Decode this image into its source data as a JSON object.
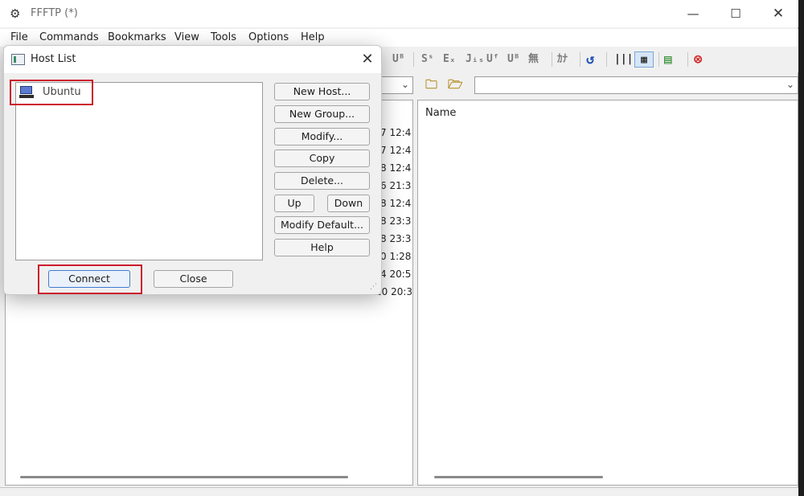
{
  "app": {
    "title": "FFFTP (*)",
    "icon": "ffftp-app-icon",
    "window_controls": {
      "minimize": "—",
      "maximize": "☐",
      "close": "✕"
    }
  },
  "menu": [
    "File",
    "Commands",
    "Bookmarks",
    "View",
    "Tools",
    "Options",
    "Help"
  ],
  "toolbar": {
    "kanji_icons": [
      "Uᴮ",
      "Sˢ",
      "Eₓ",
      "Jᵢₛ",
      "Uᶠ",
      "Uᴮ",
      "無",
      "ｶﾅ"
    ],
    "icons": [
      "refresh-icon",
      "list-view-icon",
      "detail-view-icon",
      "sync-icon",
      "stop-icon"
    ]
  },
  "right_pane": {
    "column_name": "Name"
  },
  "left_pane": {
    "times": [
      "7 12:4",
      "7 12:4",
      "8 12:4",
      "6 21:3",
      "8 12:4",
      "8 23:3",
      "8 23:3",
      "0 1:28",
      "4 20:5",
      "10 20:3"
    ]
  },
  "dialog": {
    "title": "Host List",
    "hosts": [
      {
        "label": "Ubuntu",
        "icon": "computer-icon"
      }
    ],
    "buttons": {
      "new_host": "New Host...",
      "new_group": "New Group...",
      "modify": "Modify...",
      "copy": "Copy",
      "delete": "Delete...",
      "up": "Up",
      "down": "Down",
      "modify_default": "Modify Default...",
      "help": "Help",
      "connect": "Connect",
      "close": "Close"
    },
    "highlight_color": "#cc1b2c"
  }
}
